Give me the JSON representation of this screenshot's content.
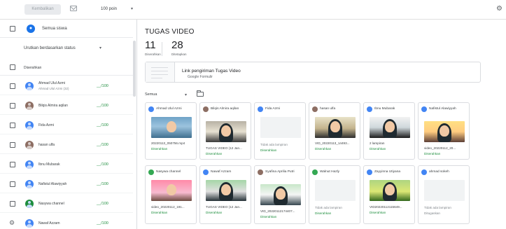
{
  "toolbar": {
    "return_label": "Kembalikan",
    "points_value": "100 poin",
    "mail_icon": "mail-icon",
    "settings_icon": "gear-icon"
  },
  "left": {
    "all_students": "Semua siswa",
    "sort_label": "Urutkan berdasarkan status",
    "section_label": "Diserahkan",
    "students": [
      {
        "name": "Ahmad Ulul Azmi",
        "sub": "Ahmad Ulul Azmi (32)",
        "grade": "__/100",
        "avatar": "default"
      },
      {
        "name": "Bilqis Almira aqilan",
        "sub": "",
        "grade": "__/100",
        "avatar": "photo"
      },
      {
        "name": "Fida Azmi",
        "sub": "",
        "grade": "__/100",
        "avatar": "default"
      },
      {
        "name": "hasan ulfa",
        "sub": "",
        "grade": "__/100",
        "avatar": "photo"
      },
      {
        "name": "Ibnu Mubarak",
        "sub": "",
        "grade": "__/100",
        "avatar": "default"
      },
      {
        "name": "Nafistul Alawiyyah",
        "sub": "",
        "grade": "__/100",
        "avatar": "default"
      },
      {
        "name": "Nasywa channel",
        "sub": "",
        "grade": "__/100",
        "avatar": "dark"
      },
      {
        "name": "Nawaf Azzam",
        "sub": "",
        "grade": "__/100",
        "avatar": "default"
      }
    ]
  },
  "main": {
    "title": "TUGAS VIDEO",
    "stats": [
      {
        "num": "11",
        "label": "Diserahkan"
      },
      {
        "num": "28",
        "label": "Ditetapkan"
      }
    ],
    "attachment": {
      "title": "Link pengiriman Tugas Video",
      "type": "Google Formulir"
    },
    "filter_value": "Semua",
    "cards": [
      {
        "name": "Ahmad Ulul Azmi",
        "thumb": "photo1",
        "file": "20220113_050756.mp4",
        "status": "Diserahkan",
        "avatar": "default"
      },
      {
        "name": "Bilqis Almira aqilan",
        "thumb": "photo2",
        "file": "TUGAS VIDEO (12 Jan...",
        "status": "Diserahkan",
        "avatar": "photo"
      },
      {
        "name": "Fida Azmi",
        "thumb": "empty",
        "file": "Tidak ada lampiran",
        "status": "Diserahkan",
        "avatar": "default"
      },
      {
        "name": "hasan ulfa",
        "thumb": "photo3",
        "file": "VID_20220113_14493...",
        "status": "Diserahkan",
        "avatar": "photo"
      },
      {
        "name": "Ibnu Mubarak",
        "thumb": "photo4",
        "file": "2 lampiran",
        "status": "Diserahkan",
        "avatar": "default"
      },
      {
        "name": "Nafistul Alawiyyah",
        "thumb": "photo5",
        "file": "video_20220112_20...",
        "status": "Diserahkan",
        "avatar": "default"
      },
      {
        "name": "Nasywa channel",
        "thumb": "photo6",
        "file": "video_20220112_191...",
        "status": "Diserahkan",
        "avatar": "green"
      },
      {
        "name": "Nawaf Azzam",
        "thumb": "photo7",
        "file": "TUGAS VIDEO (12 Jan...",
        "status": "Diserahkan",
        "avatar": "default"
      },
      {
        "name": "Syafina Aprilia Putri",
        "thumb": "photo8",
        "file": "VID_20220112174407...",
        "status": "Diserahkan",
        "avatar": "photo"
      },
      {
        "name": "Walnut Hazly",
        "thumb": "empty",
        "file": "Tidak ada lampiran",
        "status": "Diserahkan",
        "avatar": "green"
      },
      {
        "name": "Zayyinna Utiyana",
        "thumb": "photo9",
        "file": "VID20220112115649...",
        "status": "Diserahkan",
        "avatar": "default"
      },
      {
        "name": "ahmad sokeh",
        "thumb": "empty",
        "file": "Tidak ada lampiran",
        "status": "Ditugaskan",
        "avatar": "default"
      }
    ]
  }
}
